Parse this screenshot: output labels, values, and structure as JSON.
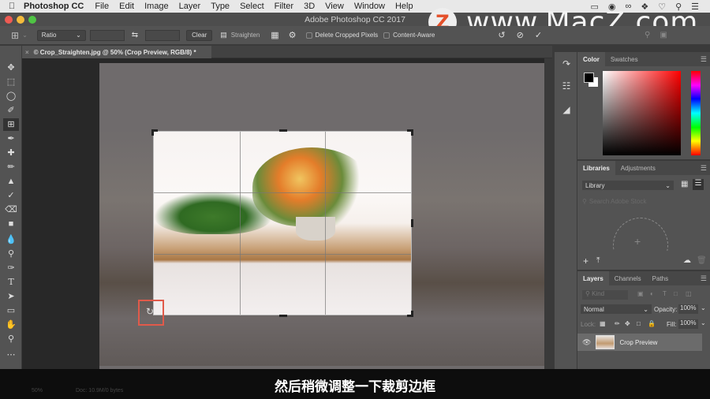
{
  "menubar": {
    "apple_icon": "apple-icon",
    "app_name": "Photoshop CC",
    "items": [
      "File",
      "Edit",
      "Image",
      "Layer",
      "Type",
      "Select",
      "Filter",
      "3D",
      "View",
      "Window",
      "Help"
    ],
    "status_icons": [
      "display-icon",
      "screen-record-icon",
      "creative-cloud-icon",
      "dropbox-icon",
      "wifi-icon",
      "spotlight-search-icon",
      "notification-list-icon"
    ]
  },
  "window": {
    "title": "Adobe Photoshop CC 2017"
  },
  "options_bar": {
    "tool_icon": "crop-icon",
    "ratio_label": "Ratio",
    "width_value": "",
    "height_value": "",
    "swap_icon": "swap-icon",
    "clear_label": "Clear",
    "straighten_label": "Straighten",
    "grid_icon": "grid-overlay-icon",
    "settings_icon": "gear-icon",
    "delete_cropped_label": "Delete Cropped Pixels",
    "delete_cropped_checked": false,
    "content_aware_label": "Content-Aware",
    "content_aware_checked": false,
    "reset_icon": "reset-icon",
    "cancel_icon": "cancel-icon",
    "commit_icon": "commit-check-icon"
  },
  "document": {
    "tab_label": "© Crop_Straighten.jpg @ 50% (Crop Preview, RGB/8) *",
    "zoom": "50%",
    "doc_info": "Doc: 10.9M/0 bytes"
  },
  "tools": [
    "move",
    "marquee",
    "lasso",
    "quick-select",
    "crop",
    "eyedropper",
    "healing-brush",
    "brush",
    "clone-stamp",
    "history-brush",
    "eraser",
    "gradient",
    "blur",
    "dodge",
    "pen",
    "type",
    "path-select",
    "rectangle",
    "hand",
    "zoom",
    "more"
  ],
  "color_panel": {
    "tabs": [
      "Color",
      "Swatches"
    ],
    "active_tab": "Color",
    "foreground": "#000000",
    "background": "#ffffff",
    "hue_color": "#ff0000"
  },
  "libraries_panel": {
    "tabs": [
      "Libraries",
      "Adjustments"
    ],
    "active_tab": "Libraries",
    "library_select": "Library",
    "search_placeholder": "Search Adobe Stock"
  },
  "layers_panel": {
    "tabs": [
      "Layers",
      "Channels",
      "Paths"
    ],
    "active_tab": "Layers",
    "filter_placeholder": "Kind",
    "blend_mode": "Normal",
    "opacity_label": "Opacity:",
    "opacity_value": "100%",
    "lock_label": "Lock:",
    "fill_label": "Fill:",
    "fill_value": "100%",
    "layers": [
      {
        "name": "Crop Preview",
        "visible": true
      }
    ]
  },
  "watermark": {
    "logo": "Z",
    "text": "www.MacZ.com"
  },
  "subtitle": "然后稍微调整一下裁剪边框"
}
